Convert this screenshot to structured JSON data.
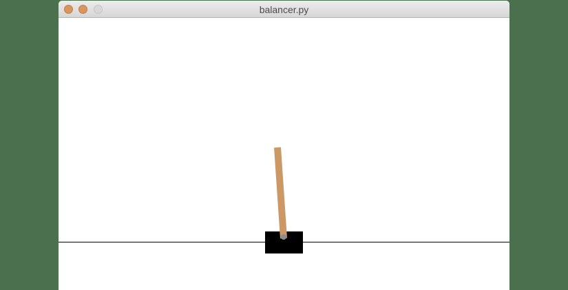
{
  "window": {
    "title": "balancer.py"
  },
  "colors": {
    "desktop": "#4a704e",
    "canvas": "#ffffff",
    "cart": "#000000",
    "pole": "#cc9966",
    "track": "#000000",
    "close_button": "#d9955e",
    "minimize_button": "#d9955e",
    "zoom_button": "#d8d8d8"
  },
  "icons": {
    "close": "close-icon",
    "minimize": "minimize-icon",
    "zoom": "zoom-icon"
  }
}
